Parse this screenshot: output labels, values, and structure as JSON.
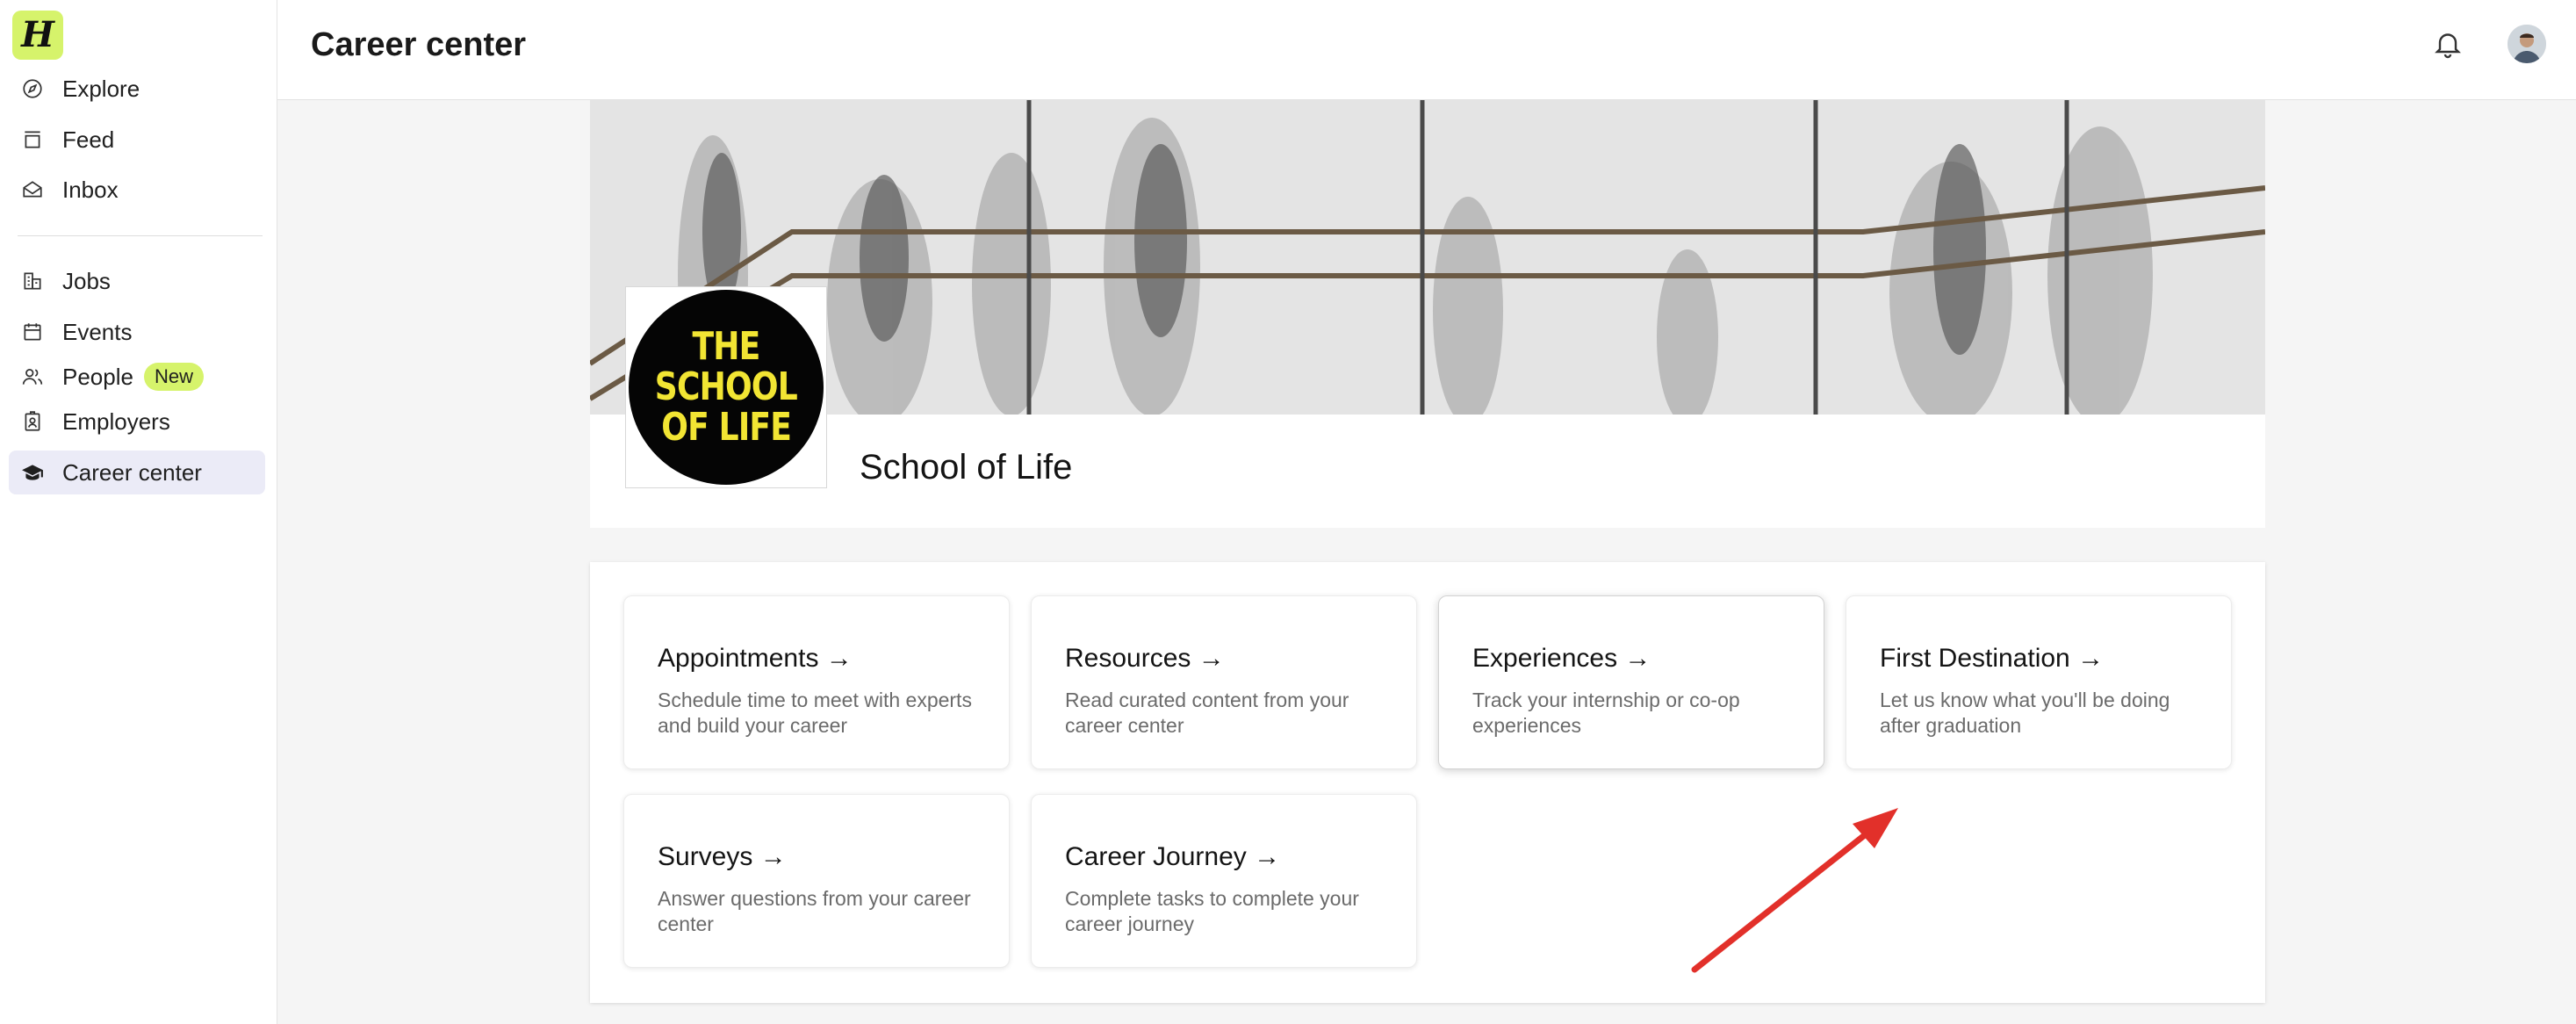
{
  "app": {
    "logo_letter": "H",
    "accent_color": "#d6f36b"
  },
  "sidebar": {
    "items": [
      {
        "label": "Explore",
        "icon": "compass-icon"
      },
      {
        "label": "Feed",
        "icon": "feed-icon"
      },
      {
        "label": "Inbox",
        "icon": "inbox-icon"
      },
      {
        "label": "Jobs",
        "icon": "building-icon"
      },
      {
        "label": "Events",
        "icon": "calendar-icon"
      },
      {
        "label": "People",
        "icon": "people-icon",
        "badge": "New"
      },
      {
        "label": "Employers",
        "icon": "employer-badge-icon"
      },
      {
        "label": "Career center",
        "icon": "graduation-cap-icon",
        "active": true
      }
    ]
  },
  "header": {
    "title": "Career center",
    "bell_icon": "bell-icon",
    "avatar_icon": "avatar"
  },
  "profile": {
    "school_name": "School of Life",
    "logo_lines": [
      "THE",
      "SCHOOL",
      "OF LIFE"
    ]
  },
  "services": {
    "cards": [
      {
        "title": "Appointments →",
        "description": "Schedule time to meet with experts and build your career"
      },
      {
        "title": "Resources →",
        "description": "Read curated content from your career center"
      },
      {
        "title": "Experiences →",
        "description": "Track your internship or co-op experiences"
      },
      {
        "title": "First Destination →",
        "description": "Let us know what you'll be doing after graduation"
      },
      {
        "title": "Surveys →",
        "description": "Answer questions from your career center"
      },
      {
        "title": "Career Journey →",
        "description": "Complete tasks to complete your career journey"
      }
    ]
  },
  "annotation": {
    "color": "#e2302a"
  }
}
